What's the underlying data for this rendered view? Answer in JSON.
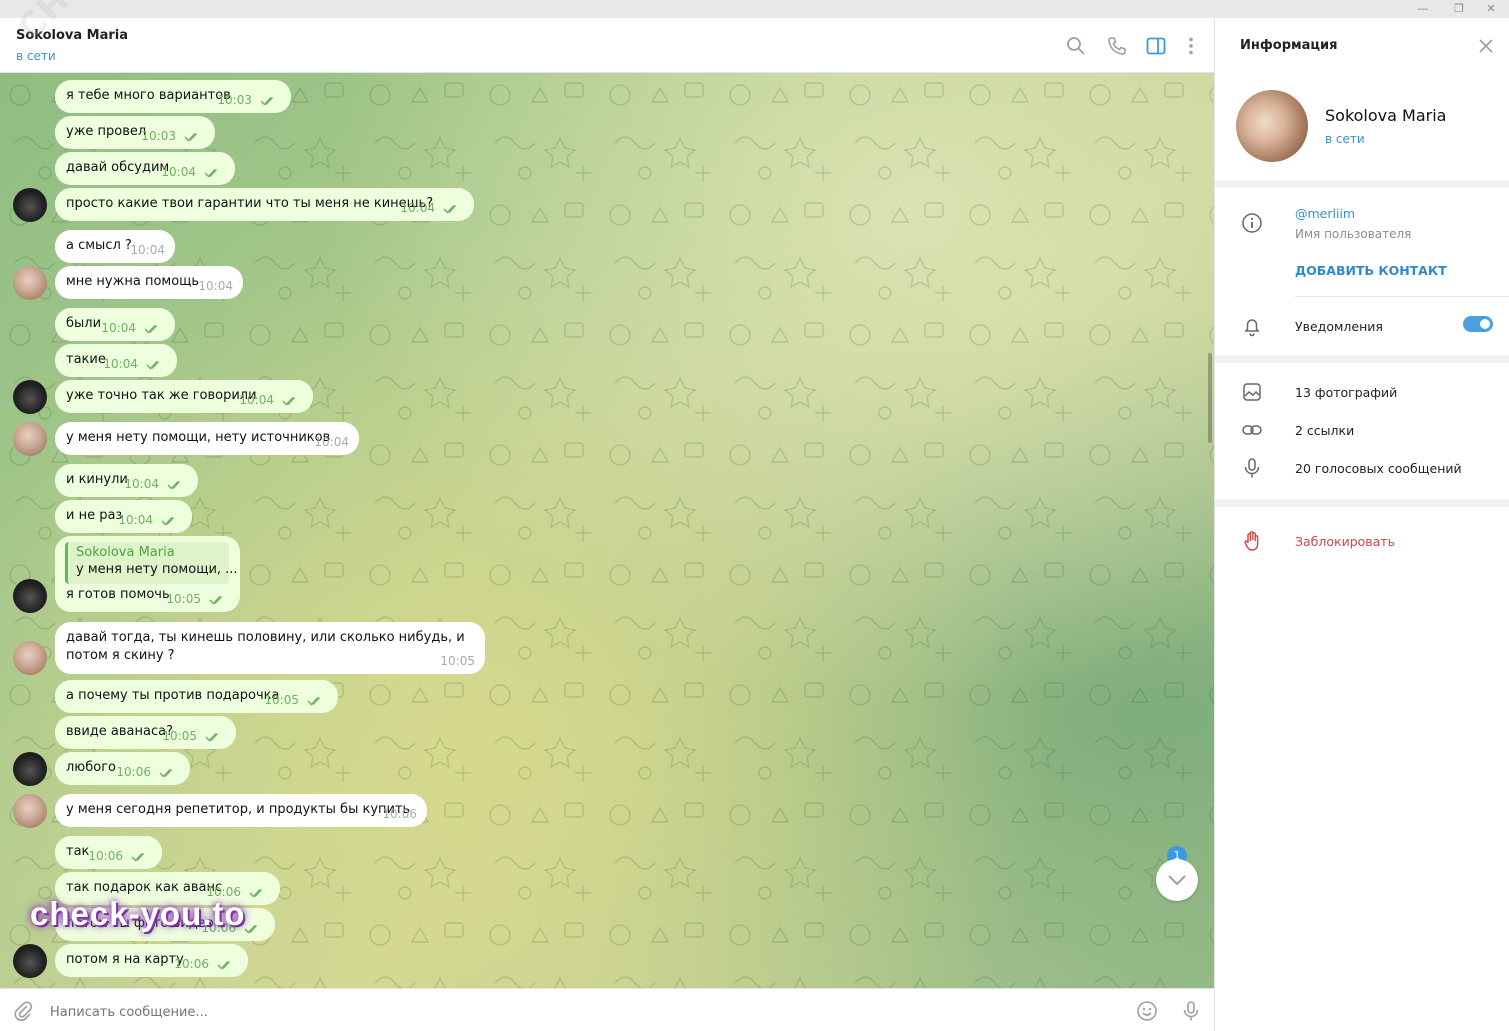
{
  "window": {
    "minimize": "—",
    "restore": "❐",
    "close": "✕"
  },
  "chat": {
    "name": "Sokolova Maria",
    "status": "в сети",
    "watermark": "CHECK-YOU.ME"
  },
  "header_icons": [
    "search-icon",
    "phone-icon",
    "sidebar-toggle-icon",
    "more-icon"
  ],
  "messages": [
    {
      "text": "я тебе много вариантов",
      "time": "10:03",
      "out": true
    },
    {
      "text": "уже провел",
      "time": "10:03",
      "out": true
    },
    {
      "text": "давай обсудим",
      "time": "10:04",
      "out": true
    },
    {
      "text": "просто какие твои гарантии что ты меня не кинешь?",
      "time": "10:04",
      "out": true
    },
    {
      "text": "а смысл ?",
      "time": "10:04",
      "out": false
    },
    {
      "text": "мне нужна помощь",
      "time": "10:04",
      "out": false
    },
    {
      "text": "были",
      "time": "10:04",
      "out": true
    },
    {
      "text": "такие",
      "time": "10:04",
      "out": true
    },
    {
      "text": "уже точно так же говорили",
      "time": "10:04",
      "out": true
    },
    {
      "text": "у меня нету помощи, нету источников",
      "time": "10:04",
      "out": false
    },
    {
      "text": "и кинули",
      "time": "10:04",
      "out": true
    },
    {
      "text": "и не раз",
      "time": "10:04",
      "out": true
    },
    {
      "text": "я готов помочь",
      "time": "10:05",
      "out": true,
      "reply_name": "Sokolova Maria",
      "reply_text": "у меня нету помощи, ..."
    },
    {
      "text": "давай тогда, ты кинешь половину, или сколько нибудь, и потом я скину ?",
      "time": "10:05",
      "out": false
    },
    {
      "text": "а почему ты против подарочка",
      "time": "10:05",
      "out": true
    },
    {
      "text": "ввиде аванаса?",
      "time": "10:05",
      "out": true
    },
    {
      "text": "любого",
      "time": "10:06",
      "out": true
    },
    {
      "text": "у меня сегодня репетитор, и продукты бы купить",
      "time": "10:06",
      "out": false
    },
    {
      "text": "так",
      "time": "10:06",
      "out": true
    },
    {
      "text": "так подарок как аванс",
      "time": "10:06",
      "out": true
    },
    {
      "text": "потом ты фото видео",
      "time": "10:06",
      "out": true
    },
    {
      "text": "потом я на карту",
      "time": "10:06",
      "out": true
    }
  ],
  "scroll_down": {
    "unread": "1"
  },
  "brand": "check-you.to",
  "composer": {
    "placeholder": "Написать сообщение..."
  },
  "info_panel": {
    "title": "Информация",
    "name": "Sokolova Maria",
    "status": "в сети",
    "username": "@merliim",
    "username_label": "Имя пользователя",
    "add_contact": "ДОБАВИТЬ КОНТАКТ",
    "notifications": "Уведомления",
    "notifications_on": true,
    "photos": "13 фотографий",
    "links": "2 ссылки",
    "voice": "20 голосовых сообщений",
    "block": "Заблокировать"
  },
  "colors": {
    "accent": "#3a8fd4",
    "outgoing_bubble": "#eeffde",
    "incoming_bubble": "#ffffff",
    "read_check": "#6fb262",
    "danger": "#d14545"
  }
}
